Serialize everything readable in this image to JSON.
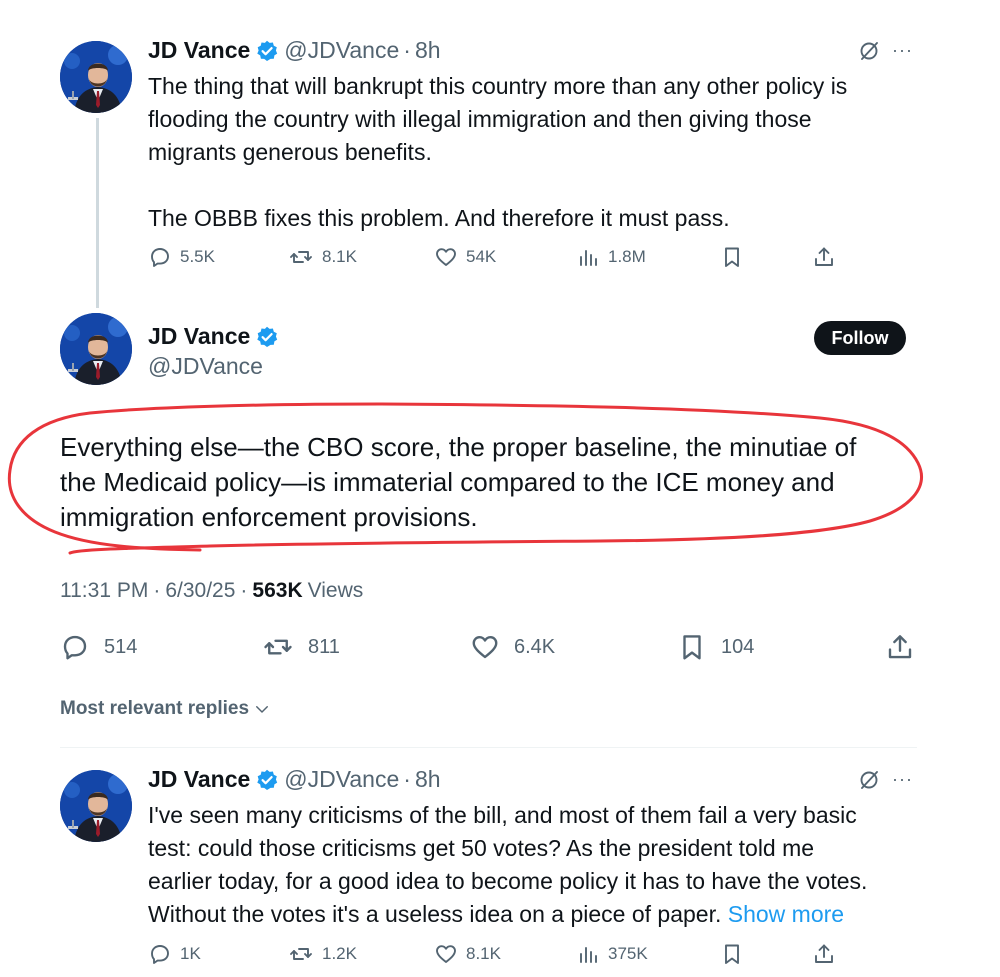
{
  "tweet1": {
    "name": "JD Vance",
    "handle": "@JDVance",
    "separator": "·",
    "time": "8h",
    "lines": [
      "The thing that will bankrupt this country more than any other policy is",
      "flooding the country with illegal immigration and then giving those",
      "migrants generous benefits.",
      "The OBBB fixes this problem. And therefore it must pass."
    ],
    "stats": {
      "replies": "5.5K",
      "reposts": "8.1K",
      "likes": "54K",
      "views": "1.8M"
    },
    "more": "···"
  },
  "main": {
    "name": "JD Vance",
    "handle": "@JDVance",
    "follow_label": "Follow",
    "lines": [
      "Everything else—the CBO score, the proper baseline, the minutiae of",
      "the Medicaid policy—is immaterial compared to the ICE money and",
      "immigration enforcement provisions."
    ],
    "meta": {
      "time": "11:31 PM",
      "date": "6/30/25",
      "separator": "·",
      "views_count": "563K",
      "views_label": "Views"
    },
    "stats": {
      "replies": "514",
      "reposts": "811",
      "likes": "6.4K",
      "bookmarks": "104"
    },
    "annotation_color": "#e8353b"
  },
  "replies_sort": {
    "label": "Most relevant replies"
  },
  "tweet3": {
    "name": "JD Vance",
    "handle": "@JDVance",
    "separator": "·",
    "time": "8h",
    "lines": [
      "I've seen many criticisms of the bill, and most of them fail a very basic",
      "test: could those criticisms get 50 votes? As the president told me",
      "earlier today, for a good idea to become policy it has to have the votes.",
      "Without the votes it's a useless idea on a piece of paper."
    ],
    "show_more": "Show more",
    "stats": {
      "replies": "1K",
      "reposts": "1.2K",
      "likes": "8.1K",
      "views": "375K"
    },
    "more": "···"
  },
  "colors": {
    "verified": "#1d9bf0",
    "link": "#1d9bf0",
    "muted": "#536471",
    "follow_bg": "#0f1419"
  }
}
